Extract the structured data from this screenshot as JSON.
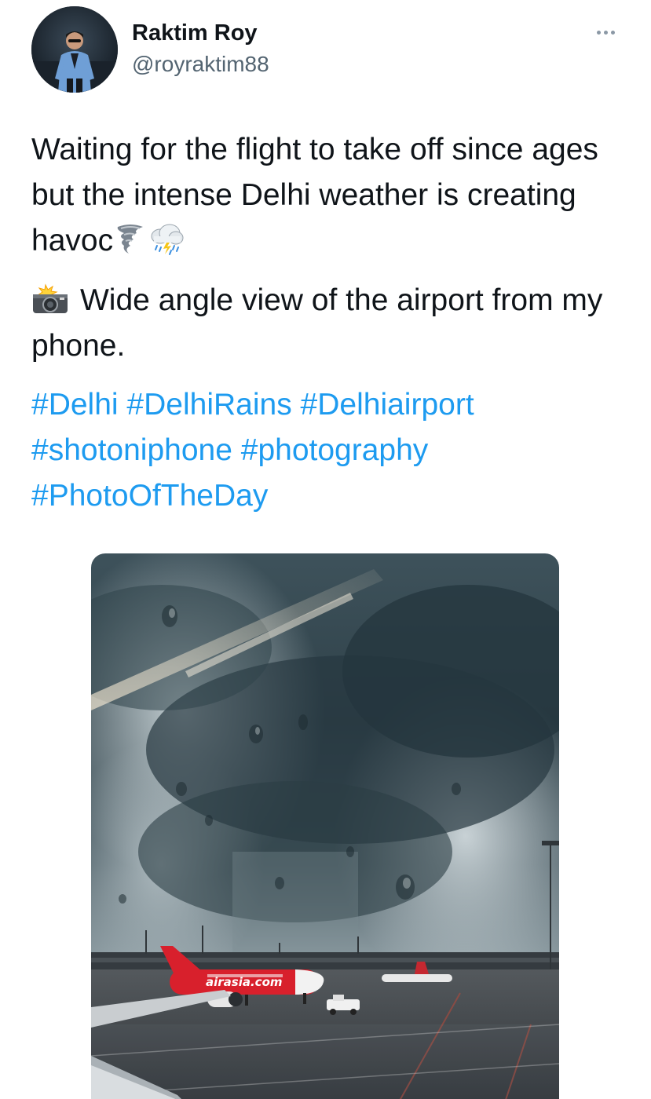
{
  "author": {
    "display_name": "Raktim Roy",
    "handle": "@royraktim88",
    "avatar_icon": "profile-photo"
  },
  "more_icon": "more-horizontal-icon",
  "tweet": {
    "line1": "Waiting for the flight to take off since ages but the intense Delhi weather is creating havoc",
    "line2": "Wide angle view of the airport from my phone.",
    "emojis": [
      "tornado-emoji",
      "rain-cloud-emoji",
      "camera-flash-emoji"
    ],
    "hashtags": [
      "#Delhi",
      "#DelhiRains",
      "#Delhiairport",
      "#shotoniphone",
      "#photography",
      "#PhotoOfTheDay"
    ]
  },
  "media": {
    "alt": "Storm clouds over airport seen through rain-streaked window",
    "aircraft_livery": "airasia.com",
    "colors": {
      "sky_dark": "#2f4048",
      "sky_light": "#c9d4d8",
      "tarmac": "#3a3f44",
      "airasia_red": "#d8202c"
    }
  },
  "colors": {
    "text": "#0f1419",
    "secondary": "#536471",
    "link": "#1d9bf0"
  }
}
